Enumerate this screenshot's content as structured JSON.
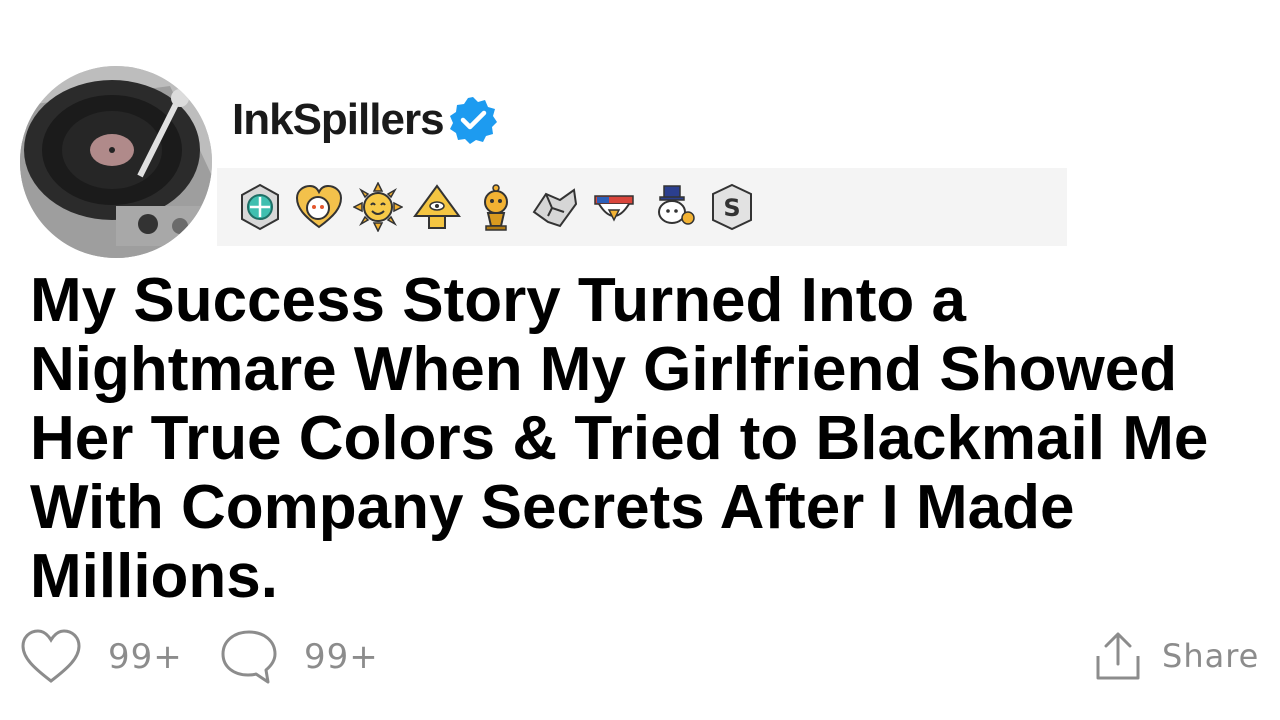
{
  "post": {
    "author": {
      "username": "InkSpillers",
      "verified": true,
      "avatar_icon": "turntable-record-avatar"
    },
    "awards": [
      {
        "icon": "platinum-award-icon"
      },
      {
        "icon": "wholesome-award-icon"
      },
      {
        "icon": "sun-face-award-icon"
      },
      {
        "icon": "illuminati-pyramid-award-icon"
      },
      {
        "icon": "gold-snoo-trophy-award-icon"
      },
      {
        "icon": "handshake-award-icon"
      },
      {
        "icon": "patriot-eagle-award-icon"
      },
      {
        "icon": "snoo-top-hat-award-icon"
      },
      {
        "icon": "silver-s-award-icon"
      }
    ],
    "title": "My Success Story Turned Into a Nightmare When My Girlfriend Showed Her True Colors & Tried to Blackmail Me With Company Secrets After I Made Millions."
  },
  "footer": {
    "likes": "99+",
    "comments": "99+",
    "share_label": "Share"
  },
  "colors": {
    "verified": "#1d9bf0",
    "muted": "#8c8c8c",
    "awards_bg": "#f4f4f4"
  }
}
